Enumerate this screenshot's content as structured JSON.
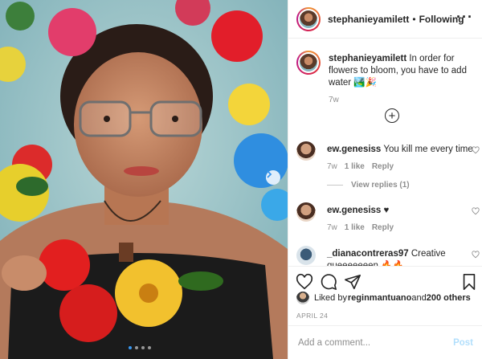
{
  "header": {
    "username": "stephanieyamilett",
    "separator": "•",
    "follow_status": "Following",
    "more_icon": "more-horizontal-icon"
  },
  "caption": {
    "username": "stephanieyamilett",
    "text": " In order for flowers to bloom, you have to add water 🏞️🎉",
    "timestamp": "7w"
  },
  "comments": [
    {
      "username": "ew.genesiss",
      "text": " You kill me every time",
      "time": "7w",
      "likes": "1 like",
      "reply": "Reply"
    },
    {
      "username": "ew.genesiss",
      "text": " ♥",
      "time": "7w",
      "likes": "1 like",
      "reply": "Reply"
    },
    {
      "username": "_dianacontreras97",
      "text": " Creative queeeeeeen 🔥🔥"
    }
  ],
  "view_replies": "View replies (1)",
  "likes": {
    "prefix": "Liked by ",
    "user": "reginmantuano",
    "middle": " and ",
    "others": "200 others"
  },
  "date": "APRIL 24",
  "add_comment": {
    "placeholder": "Add a comment...",
    "post_label": "Post"
  },
  "carousel": {
    "slides": 4,
    "active": 1
  },
  "colors": {
    "accent": "#3897f0",
    "post_disabled": "#b2dffc",
    "muted": "#8e8e8e"
  }
}
